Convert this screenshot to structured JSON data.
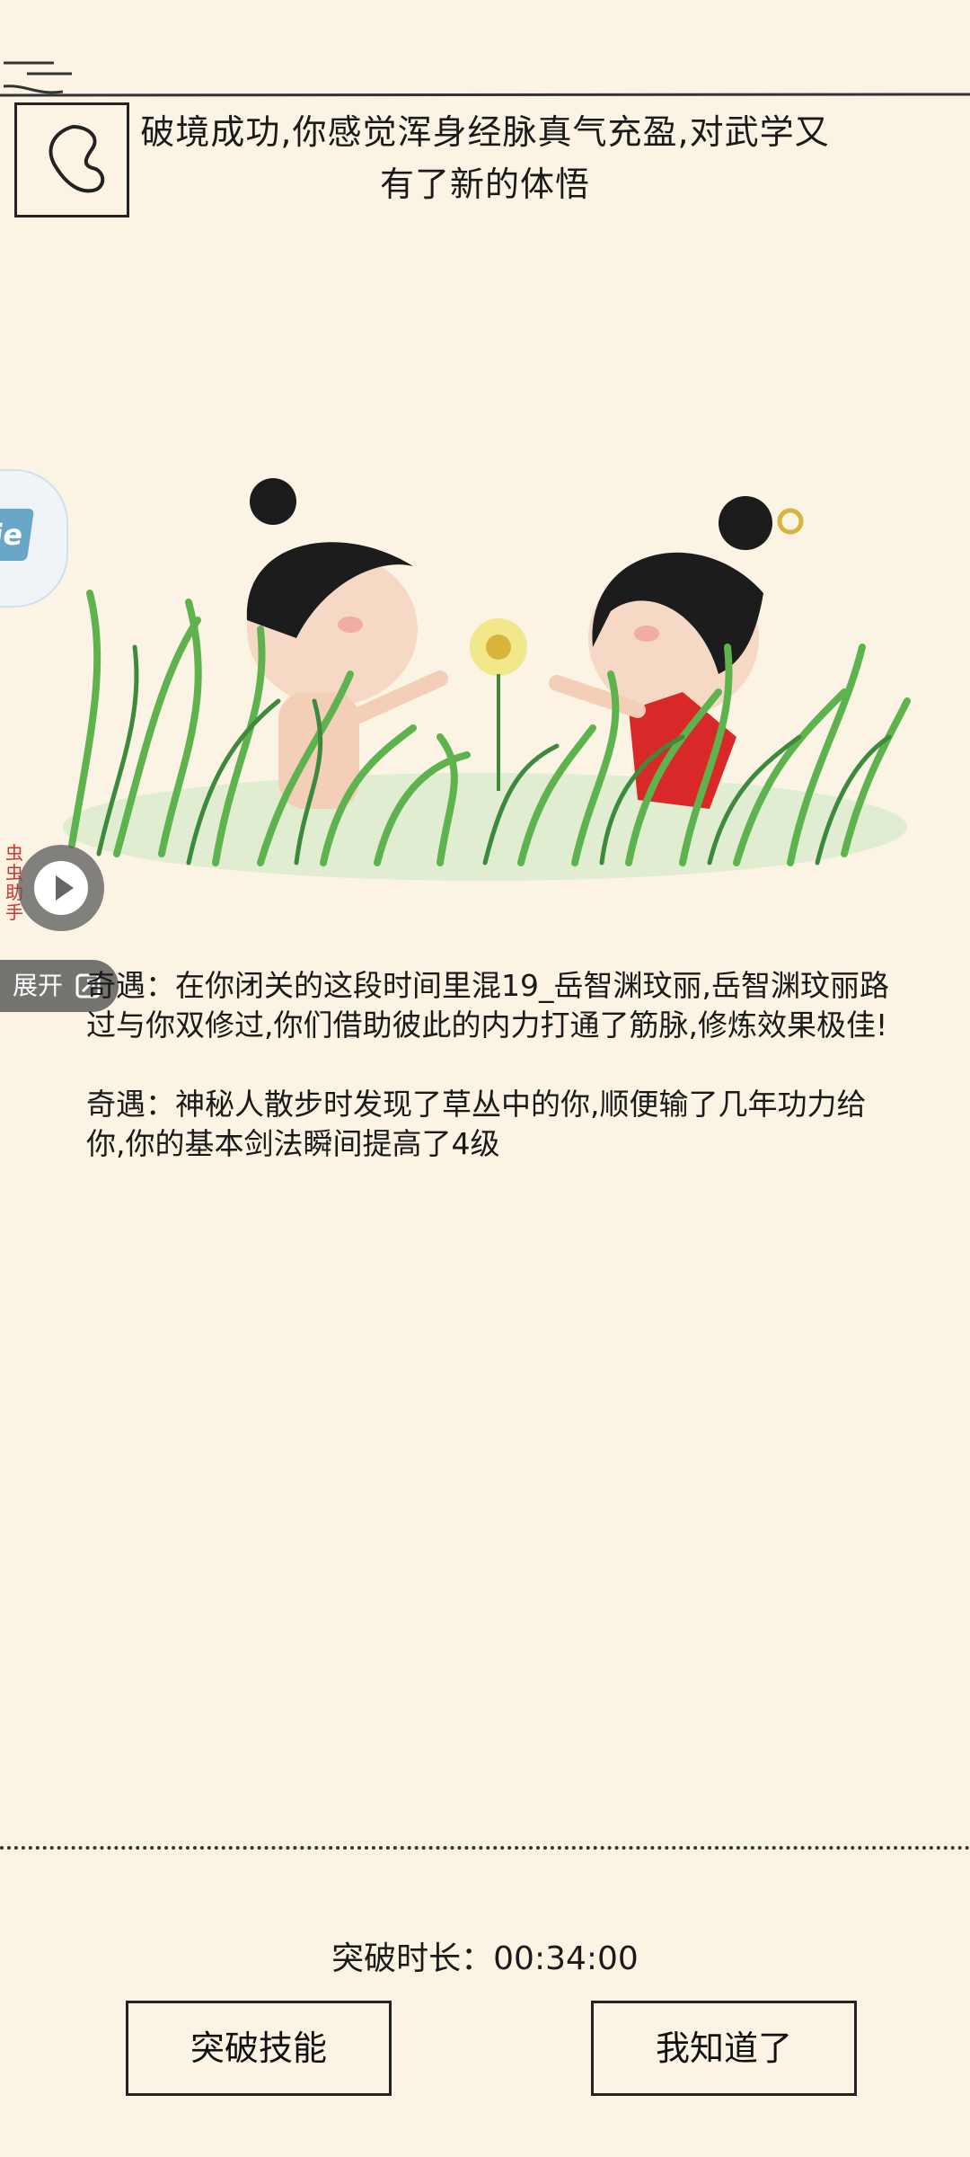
{
  "header": {
    "back_icon": "back-arrow-icon",
    "headline": "破境成功,你感觉浑身经脉真气充盈,对武学又有了新的体悟"
  },
  "illustration": {
    "description_icon": "two-children-in-grass-illustration"
  },
  "overlay": {
    "float_badge": "ie",
    "vertical_label": "虫虫助手",
    "expand_label": "展开"
  },
  "events": [
    "奇遇：在你闭关的这段时间里混19_岳智渊玟丽,岳智渊玟丽路过与你双修过,你们借助彼此的内力打通了筋脉,修炼效果极佳!",
    "奇遇：神秘人散步时发现了草丛中的你,顺便输了几年功力给你,你的基本剑法瞬间提高了4级"
  ],
  "footer": {
    "duration_label": "突破时长：00:34:00",
    "skill_button": "突破技能",
    "ok_button": "我知道了"
  },
  "colors": {
    "background": "#fbf4e4",
    "ink": "#222222",
    "grass": "#5fb34f",
    "dress": "#d82828"
  }
}
